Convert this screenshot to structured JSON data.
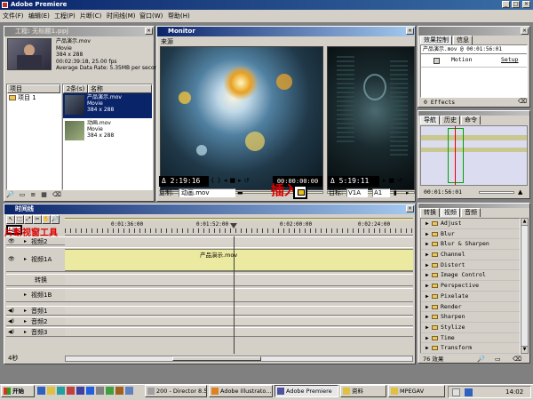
{
  "app": {
    "title": "Adobe Premiere"
  },
  "menu": [
    "文件(F)",
    "编辑(E)",
    "工程(P)",
    "片断(C)",
    "时间线(M)",
    "窗口(W)",
    "帮助(H)"
  ],
  "project": {
    "title": "工程: 无标题1.ppj",
    "clip_name": "产品演示.mov",
    "clip_type": "Movie",
    "clip_size": "384 x 288",
    "clip_duration": "00:02:39:18, 25.00 fps",
    "clip_rate": "Average Data Rate: 5.35MB per second",
    "bin_header": "项目",
    "bin_item": "项目 1",
    "count_header": "2条(s)",
    "name_header": "名称",
    "items": [
      {
        "name": "产品演示.mov",
        "type": "Movie",
        "size": "384 x 288"
      },
      {
        "name": "动画.mov",
        "type": "Movie",
        "size": "384 x 288"
      }
    ]
  },
  "monitor": {
    "title": "Monitor",
    "source_label": "来源",
    "source_timecode": "Δ 2:19:16",
    "program_timecode": "Δ 5:19:11",
    "source_tc_mid": "00:00:00:00",
    "source_clip_label": "复制:",
    "source_clip": "动画.mov",
    "target_label": "目标:",
    "target_v": "V1A",
    "target_a": "A1",
    "annotation_insert": "插入"
  },
  "effect_controls": {
    "tab_label": "效果控制",
    "info_tab": "信息",
    "clip_line": "产品演示.mov @ 00:01:56:01",
    "motion_label": "Motion",
    "setup_label": "Setup",
    "effects_count": "0 Effects"
  },
  "navigator": {
    "tabs": [
      "导航",
      "历史",
      "命令"
    ],
    "timecode": "00:01:56:01"
  },
  "effects": {
    "tabs": [
      "转换",
      "视频",
      "音频"
    ],
    "items": [
      "Adjust",
      "Blur",
      "Blur & Sharpen",
      "Channel",
      "Distort",
      "Image Control",
      "Perspective",
      "Pixelate",
      "Render",
      "Sharpen",
      "Stylize",
      "Time",
      "Transform"
    ],
    "footer": "76 效果"
  },
  "timeline": {
    "title": "时间线",
    "ruler": [
      "0:01:36:00",
      "0:01:52:00",
      "0:02:00:00",
      "0:02:24:00"
    ],
    "tracks": {
      "v2": "视频2",
      "v1a": "视频1A",
      "trans": "转换",
      "v1b": "视频1B",
      "a1": "音频1",
      "a2": "音频2",
      "a3": "音频3"
    },
    "clip_label": "产品演示.mov",
    "zoom": "4秒",
    "annotation_tool": "片断视窗工具"
  },
  "taskbar": {
    "start": "开始",
    "items": [
      "200 - Director 8.5",
      "Adobe Illustrato...",
      "Adobe Premiere",
      "资料",
      "MPEGAV"
    ],
    "clock": "14:02"
  }
}
